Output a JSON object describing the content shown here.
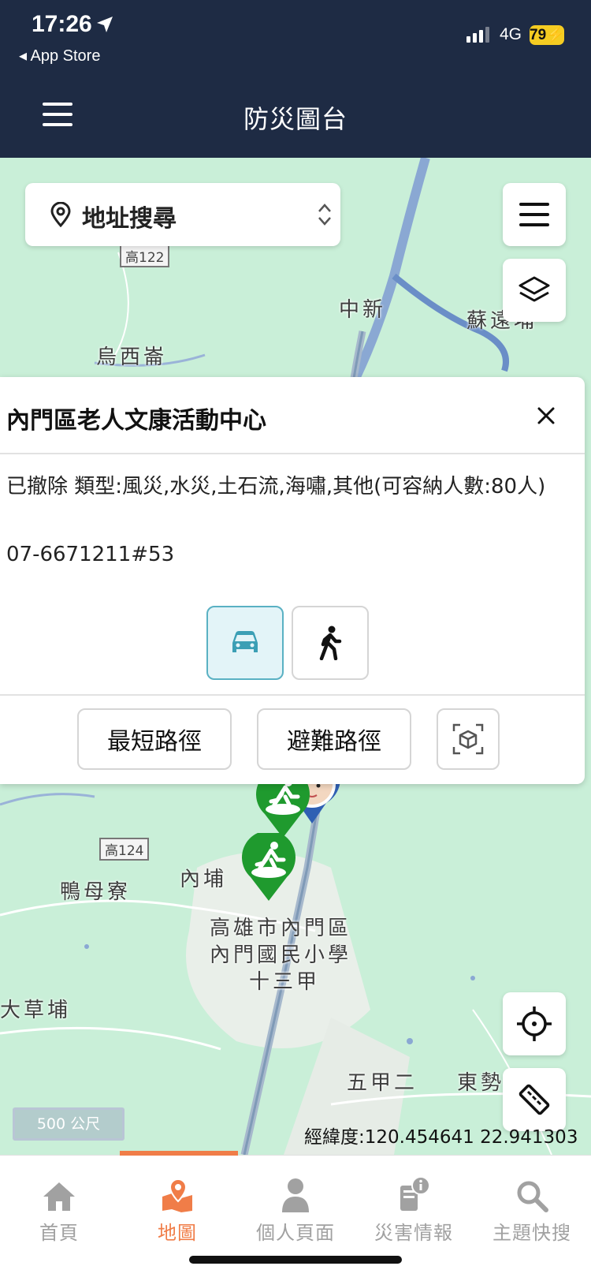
{
  "status_bar": {
    "time": "17:26",
    "back_app": "◂ App Store",
    "network": "4G",
    "battery": "79"
  },
  "header": {
    "title": "防災圖台"
  },
  "map": {
    "search_label": "地址搜尋",
    "labels": [
      "中新",
      "蘇遠埔",
      "烏西崙",
      "鴨母寮",
      "內埔",
      "高雄市內門區",
      "內門國民小學",
      "十三甲",
      "大草埔",
      "五甲二",
      "東勢"
    ],
    "road_shields": [
      "高122",
      "高124"
    ],
    "scale": "500 公尺",
    "coordinates": "經緯度:120.454641 22.941303"
  },
  "info_card": {
    "title": "內門區老人文康活動中心",
    "description": "已撤除 類型:風災,水災,土石流,海嘯,其他(可容納人數:80人)",
    "phone": "07-6671211#53",
    "route_shortest": "最短路徑",
    "route_evacuation": "避難路徑"
  },
  "bottom_nav": {
    "items": [
      {
        "label": "首頁",
        "icon": "home-icon"
      },
      {
        "label": "地圖",
        "icon": "map-icon"
      },
      {
        "label": "個人頁面",
        "icon": "person-icon"
      },
      {
        "label": "災害情報",
        "icon": "disaster-info-icon"
      },
      {
        "label": "主題快搜",
        "icon": "search-icon"
      }
    ],
    "active_index": 1
  },
  "colors": {
    "header_bg": "#1e2b44",
    "map_bg": "#c9efd8",
    "accent": "#f07d48",
    "marker_green": "#1f9a2e",
    "active_mode": "#5ab1c3"
  }
}
